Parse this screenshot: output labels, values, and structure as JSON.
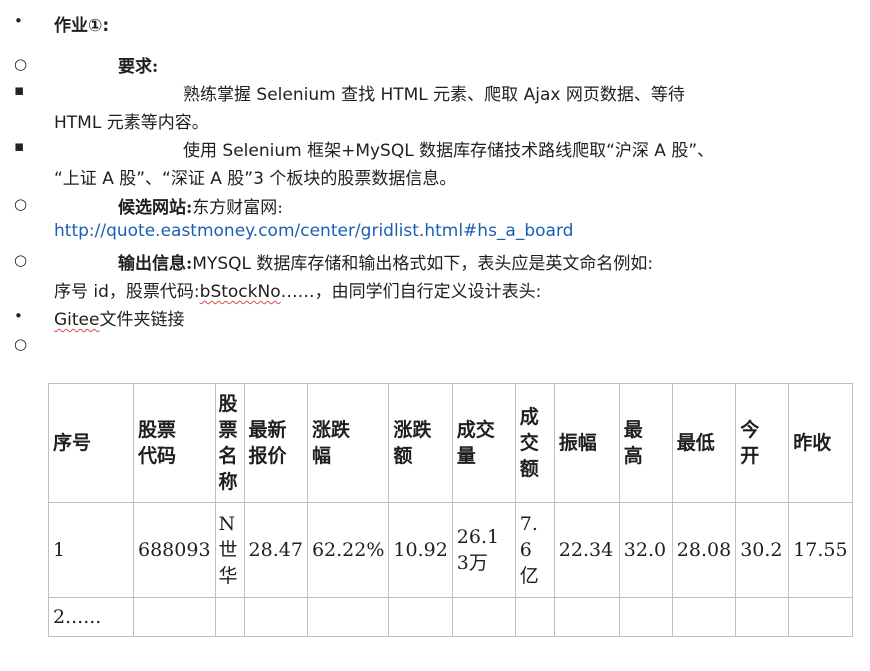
{
  "bullets": {
    "disc": "•",
    "circle": "○",
    "square": "▪"
  },
  "doc": {
    "heading": "作业①:",
    "req_label": "要求:",
    "req1_line1": "熟练掌握 Selenium 查找 HTML 元素、爬取 Ajax 网页数据、等待",
    "req1_line2": "HTML 元素等内容。",
    "req2_line1": "使用 Selenium 框架+MySQL 数据库存储技术路线爬取“沪深 A 股”、",
    "req2_line2": "“上证 A 股”、“深证 A 股”3 个板块的股票数据信息。",
    "site_label": "候选网站:",
    "site_name": "东方财富网:",
    "url": "http://quote.eastmoney.com/center/gridlist.html#hs_a_board",
    "output_label": "输出信息:",
    "output_text": "MYSQL 数据库存储和输出格式如下，表头应是英文命名例如:",
    "output_line2_a": "序号 id，股票代码:",
    "output_line2_b": "bStockNo",
    "output_line2_c": "……，由同学们自行定义设计表头:",
    "gitee_a": "Gitee",
    "gitee_b": "文件夹链接"
  },
  "table": {
    "headers": [
      "序号",
      "股票代码",
      "股票名称",
      "最新报价",
      "涨跌幅",
      "涨跌额",
      "成交量",
      "成交额",
      "振幅",
      "最高",
      "最低",
      "今开",
      "昨收"
    ],
    "row1": [
      "1",
      "688093",
      "N世华",
      "28.47",
      "62.22%",
      "10.92",
      "26.13万",
      "7.6亿",
      "22.34",
      "32.0",
      "28.08",
      "30.2",
      "17.55"
    ],
    "row2_first": "2......"
  }
}
